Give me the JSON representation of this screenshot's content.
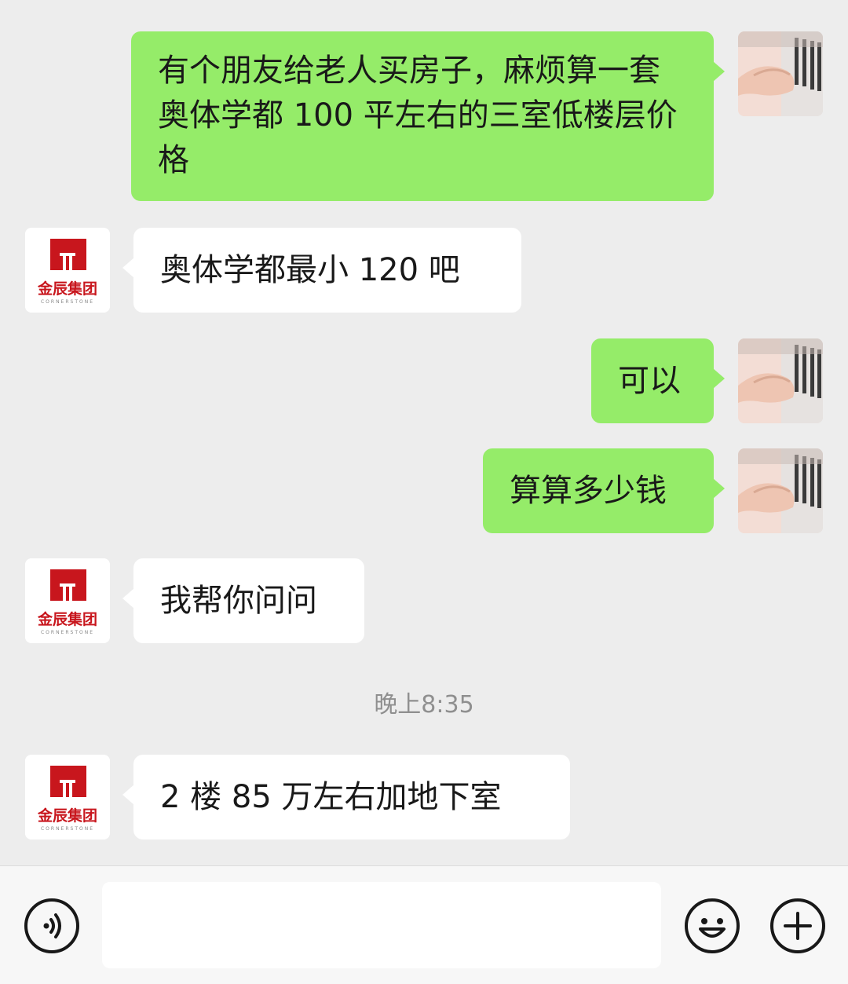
{
  "messages": [
    {
      "side": "sent",
      "text": "有个朋友给老人买房子，麻烦算一套奥体学都 100 平左右的三室低楼层价格"
    },
    {
      "side": "received",
      "text": "奥体学都最小 120 吧"
    },
    {
      "side": "sent",
      "text": "可以"
    },
    {
      "side": "sent",
      "text": "算算多少钱"
    },
    {
      "side": "received",
      "text": "我帮你问问"
    },
    {
      "side": "received",
      "text": "2 楼 85 万左右加地下室"
    }
  ],
  "timestamp": "晚上8:35",
  "contact_avatar": {
    "logo_text": "金辰集团",
    "logo_subtext": "CORNERSTONE",
    "brand_color": "#c8161d"
  },
  "input_bar": {
    "voice_icon": "voice-icon",
    "emoji_icon": "emoji-icon",
    "plus_icon": "plus-icon",
    "input_value": ""
  },
  "colors": {
    "sent_bubble": "#95ec69",
    "received_bubble": "#ffffff",
    "background": "#ededed"
  }
}
